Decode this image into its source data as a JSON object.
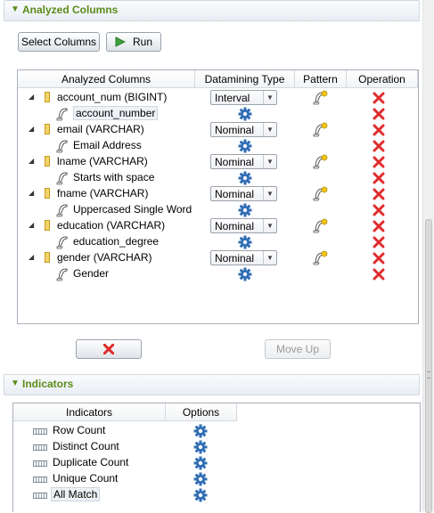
{
  "analyzed_section": {
    "title": "Analyzed Columns",
    "buttons": {
      "select_columns": "Select Columns",
      "run": "Run"
    },
    "table": {
      "headers": [
        "Analyzed Columns",
        "Datamining Type",
        "Pattern",
        "Operation"
      ],
      "rows": [
        {
          "column": "account_num (BIGINT)",
          "type": "Interval",
          "pattern": "account_number"
        },
        {
          "column": "email (VARCHAR)",
          "type": "Nominal",
          "pattern": "Email Address"
        },
        {
          "column": "lname (VARCHAR)",
          "type": "Nominal",
          "pattern": "Starts with space"
        },
        {
          "column": "fname (VARCHAR)",
          "type": "Nominal",
          "pattern": "Uppercased Single Word"
        },
        {
          "column": "education (VARCHAR)",
          "type": "Nominal",
          "pattern": "education_degree"
        },
        {
          "column": "gender (VARCHAR)",
          "type": "Nominal",
          "pattern": "Gender"
        }
      ]
    },
    "bottom_buttons": {
      "move_up": "Move Up"
    }
  },
  "indicators_section": {
    "title": "Indicators",
    "table": {
      "headers": [
        "Indicators",
        "Options"
      ],
      "rows": [
        "Row Count",
        "Distinct Count",
        "Duplicate Count",
        "Unique Count",
        "All Match"
      ]
    }
  },
  "colors": {
    "section_title": "#5b8b1a",
    "delete": "#e02b2b",
    "gear": "#2f6db5",
    "run_arrow": "#3aa23a"
  },
  "icons": {
    "section_twisty": "triangle-down-icon",
    "run": "play-icon",
    "column": "column-icon",
    "pattern": "regex-pattern-icon",
    "options": "gear-icon",
    "delete": "red-x-icon",
    "indicator": "ruler-icon"
  }
}
